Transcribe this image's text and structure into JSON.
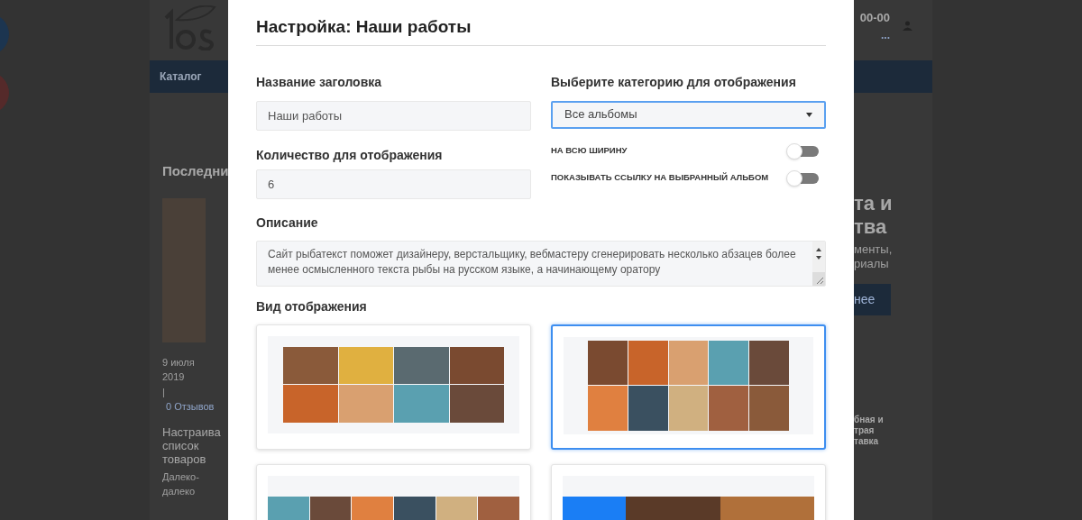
{
  "background": {
    "nav": {
      "label": "Каталог"
    },
    "phone": "00-00",
    "phone_link": "...",
    "left_column": {
      "heading": "Последни",
      "date": "9 июля 2019",
      "separator": "|",
      "reviews": "0 Отзывов",
      "product_title": "Настраива список товаров",
      "product_text": "Далеко- далеко"
    },
    "right_column": {
      "banner_title": "та и тва",
      "banner_text": "менты, риалы",
      "banner_button": "нее",
      "feature": "бная и трая тавка"
    }
  },
  "modal": {
    "title": "Настройка: Наши работы",
    "heading_field": {
      "label": "Название заголовка",
      "value": "Наши работы"
    },
    "count_field": {
      "label": "Количество для отображения",
      "value": "6"
    },
    "category": {
      "label": "Выберите категорию для отображения",
      "value": "Все альбомы"
    },
    "toggles": [
      {
        "label": "НА ВСЮ ШИРИНУ",
        "on": false
      },
      {
        "label": "ПОКАЗЫВАТЬ ССЫЛКУ НА ВЫБРАННЫЙ АЛЬБОМ",
        "on": false
      }
    ],
    "description": {
      "label": "Описание",
      "value": "Сайт рыбатекст поможет дизайнеру, верстальщику, вебмастеру сгенерировать несколько абзацев более менее осмысленного текста рыбы на русском языке, а начинающему оратору"
    },
    "layouts_label": "Вид отображения",
    "layouts": [
      {
        "kind": "grid4",
        "selected": false
      },
      {
        "kind": "mosaic",
        "selected": true
      },
      {
        "kind": "grid6",
        "selected": false
      },
      {
        "kind": "banner",
        "selected": false
      }
    ]
  }
}
